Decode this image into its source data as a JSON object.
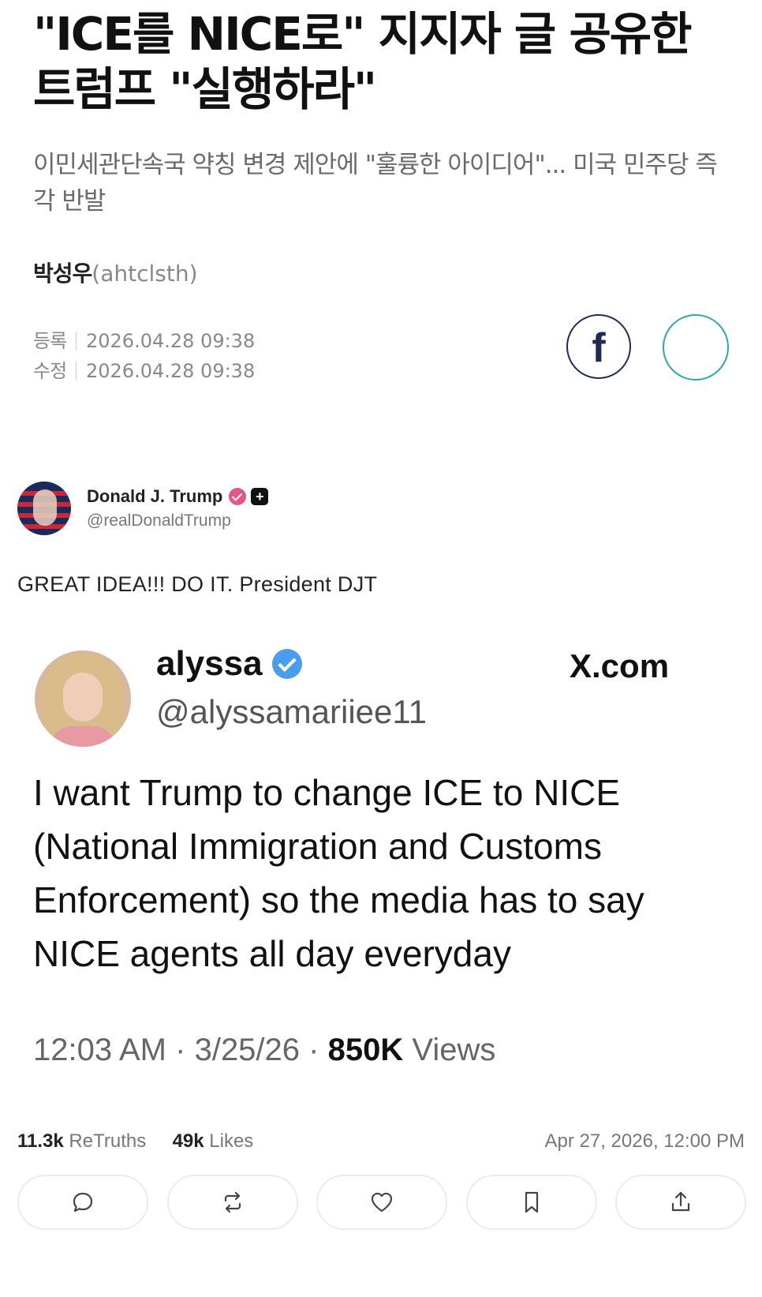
{
  "article": {
    "headline": "\"ICE를 NICE로\" 지지자 글 공유한 트럼프 \"실행하라\"",
    "subheadline": "이민세관단속국 약칭 변경 제안에 \"훌륭한 아이디어\"... 미국 민주당 즉각 반발",
    "author_name": "박성우",
    "author_id": "(ahtclsth)",
    "registered_label": "등록",
    "registered_time": "2026.04.28 09:38",
    "modified_label": "수정",
    "modified_time": "2026.04.28 09:38",
    "share_facebook_glyph": "f"
  },
  "truth_post": {
    "author_name": "Donald J. Trump",
    "author_handle": "@realDonaldTrump",
    "text": "GREAT IDEA!!! DO IT.  President DJT",
    "retruths_count": "11.3k",
    "retruths_label": "ReTruths",
    "likes_count": "49k",
    "likes_label": "Likes",
    "timestamp": "Apr 27, 2026, 12:00 PM"
  },
  "quoted_x_post": {
    "author_name": "alyssa",
    "author_handle": "@alyssamariiee11",
    "source": "X.com",
    "body": "I want Trump to change ICE to NICE (National Immigration and Customs Enforcement) so the media has to say NICE agents all day everyday",
    "time": "12:03 AM",
    "date": "3/25/26",
    "views_count": "850K",
    "views_label": "Views"
  },
  "actions": [
    {
      "icon": "reply-icon"
    },
    {
      "icon": "retruth-icon"
    },
    {
      "icon": "like-icon"
    },
    {
      "icon": "bookmark-icon"
    },
    {
      "icon": "share-icon"
    }
  ],
  "colors": {
    "verified_badge": "#e2568a",
    "x_verified": "#4a9ded",
    "facebook": "#1e2c55",
    "share_circle": "#2fa6a8"
  }
}
